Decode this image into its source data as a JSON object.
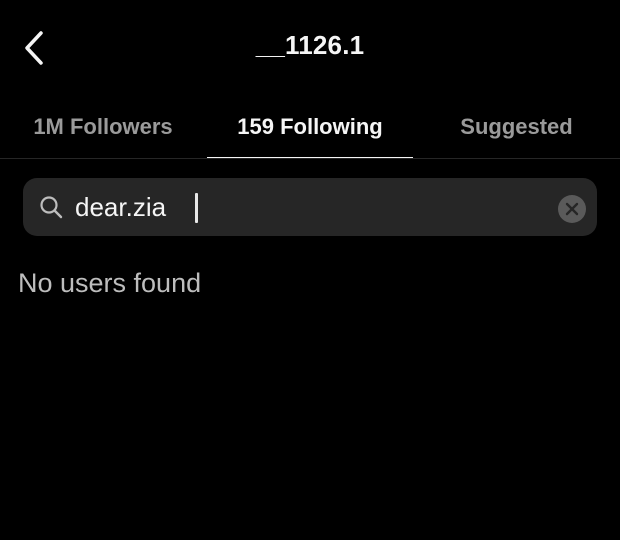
{
  "header": {
    "title": "__1126.1",
    "back_icon": "chevron-left-icon"
  },
  "tabs": [
    {
      "label": "1M Followers",
      "active": false
    },
    {
      "label": "159 Following",
      "active": true
    },
    {
      "label": "Suggested",
      "active": false
    }
  ],
  "search": {
    "value": "dear.zia",
    "icon": "search-icon",
    "clear_icon": "clear-icon"
  },
  "results": {
    "empty_message": "No users found"
  },
  "colors": {
    "background": "#000000",
    "text_primary": "#f5f5f5",
    "text_secondary": "#9a9a9a",
    "search_bg": "#262626",
    "divider": "#262626"
  }
}
